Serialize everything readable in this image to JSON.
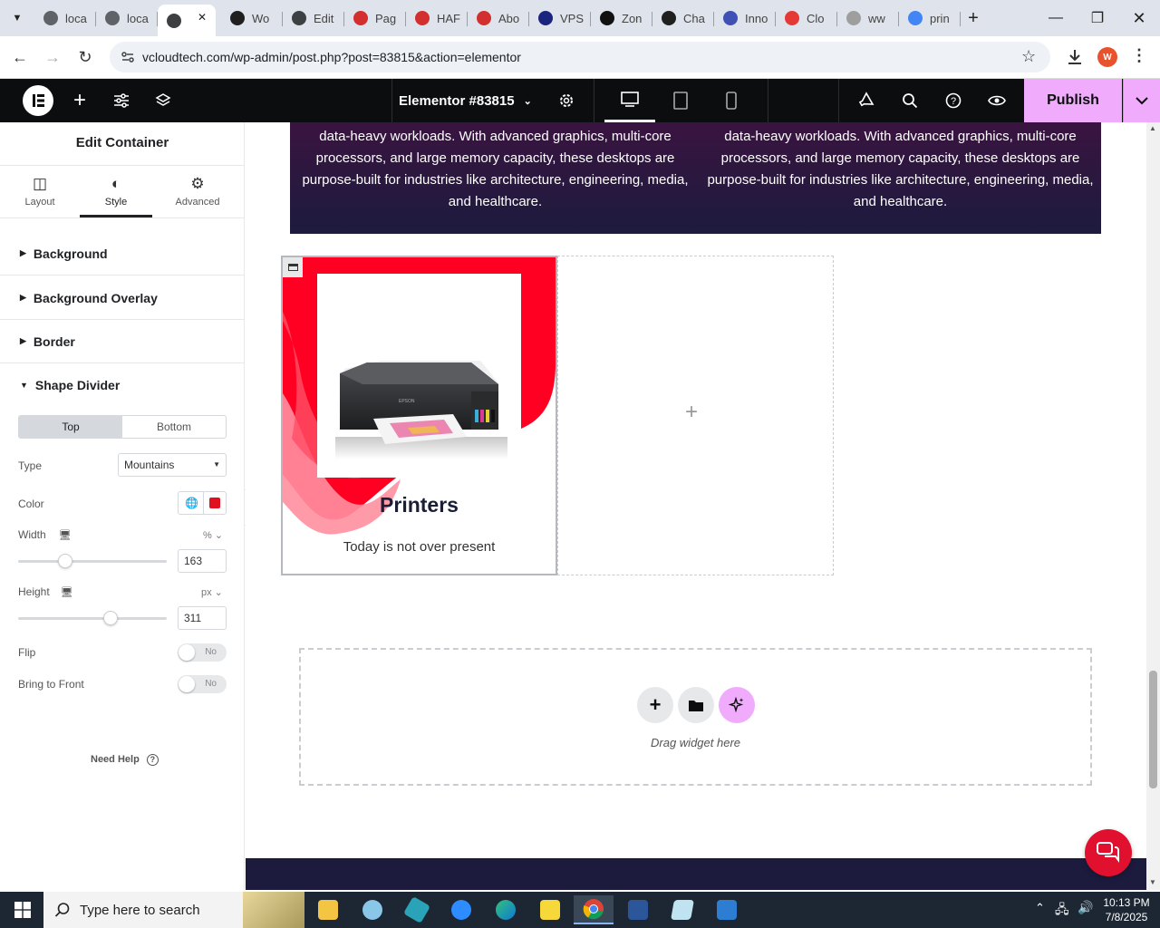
{
  "browser": {
    "tabs": [
      {
        "label": "loca",
        "color": "#5f6368"
      },
      {
        "label": "loca",
        "color": "#5f6368"
      },
      {
        "label": "",
        "color": "#3c4043",
        "active": true
      },
      {
        "label": "Wo",
        "color": "#1f1f1f"
      },
      {
        "label": "Edit",
        "color": "#3c4043"
      },
      {
        "label": "Pag",
        "color": "#d32f2f"
      },
      {
        "label": "HAF",
        "color": "#d32f2f"
      },
      {
        "label": "Abo",
        "color": "#d32f2f"
      },
      {
        "label": "VPS",
        "color": "#1a237e"
      },
      {
        "label": "Zon",
        "color": "#111111"
      },
      {
        "label": "Cha",
        "color": "#1f1f1f"
      },
      {
        "label": "Inno",
        "color": "#3f51b5"
      },
      {
        "label": "Clo",
        "color": "#e53935"
      },
      {
        "label": "ww",
        "color": "#9e9e9e"
      },
      {
        "label": "prin",
        "color": "#4285f4"
      }
    ],
    "url": "vcloudtech.com/wp-admin/post.php?post=83815&action=elementor",
    "profile_initial": "W"
  },
  "editor": {
    "document_title": "Elementor #83815",
    "publish_label": "Publish"
  },
  "panel": {
    "title": "Edit Container",
    "tabs": [
      {
        "label": "Layout",
        "icon": "layout-icon"
      },
      {
        "label": "Style",
        "icon": "half-circle-icon"
      },
      {
        "label": "Advanced",
        "icon": "gear-icon"
      }
    ],
    "sections": [
      "Background",
      "Background Overlay",
      "Border"
    ],
    "shape_divider": {
      "title": "Shape Divider",
      "position_tabs": [
        "Top",
        "Bottom"
      ],
      "type_label": "Type",
      "type_value": "Mountains",
      "color_label": "Color",
      "color_value": "#e0101e",
      "width_label": "Width",
      "width_unit": "%",
      "width_value": "163",
      "width_fraction": 0.32,
      "height_label": "Height",
      "height_unit": "px",
      "height_value": "311",
      "height_fraction": 0.62,
      "flip_label": "Flip",
      "flip_value": "No",
      "front_label": "Bring to Front",
      "front_value": "No"
    },
    "help_label": "Need Help"
  },
  "canvas": {
    "banner_text": "data-heavy workloads. With advanced graphics, multi-core processors, and large memory capacity, these desktops are purpose-built for industries like architecture, engineering, media, and healthcare.",
    "banner_text_right": "data-heavy workloads. With advanced graphics, multi-core processors, and large memory capacity, these desktops are purpose-built for industries like architecture, engineering, media, and healthcare.",
    "card_title": "Printers",
    "card_text": "Today is not over present",
    "printer_brand": "EPSON",
    "drop_label": "Drag widget here"
  },
  "taskbar": {
    "search_placeholder": "Type here to search",
    "time": "10:13 PM",
    "date": "7/8/2025"
  },
  "colors": {
    "elementor_bar": "#0c0d0e",
    "publish_bg": "#f0abfc",
    "banner_top": "#3a1440",
    "banner_bottom": "#1c1b3e",
    "card_red": "#ff0022",
    "chat_bubble": "#e0102e"
  }
}
